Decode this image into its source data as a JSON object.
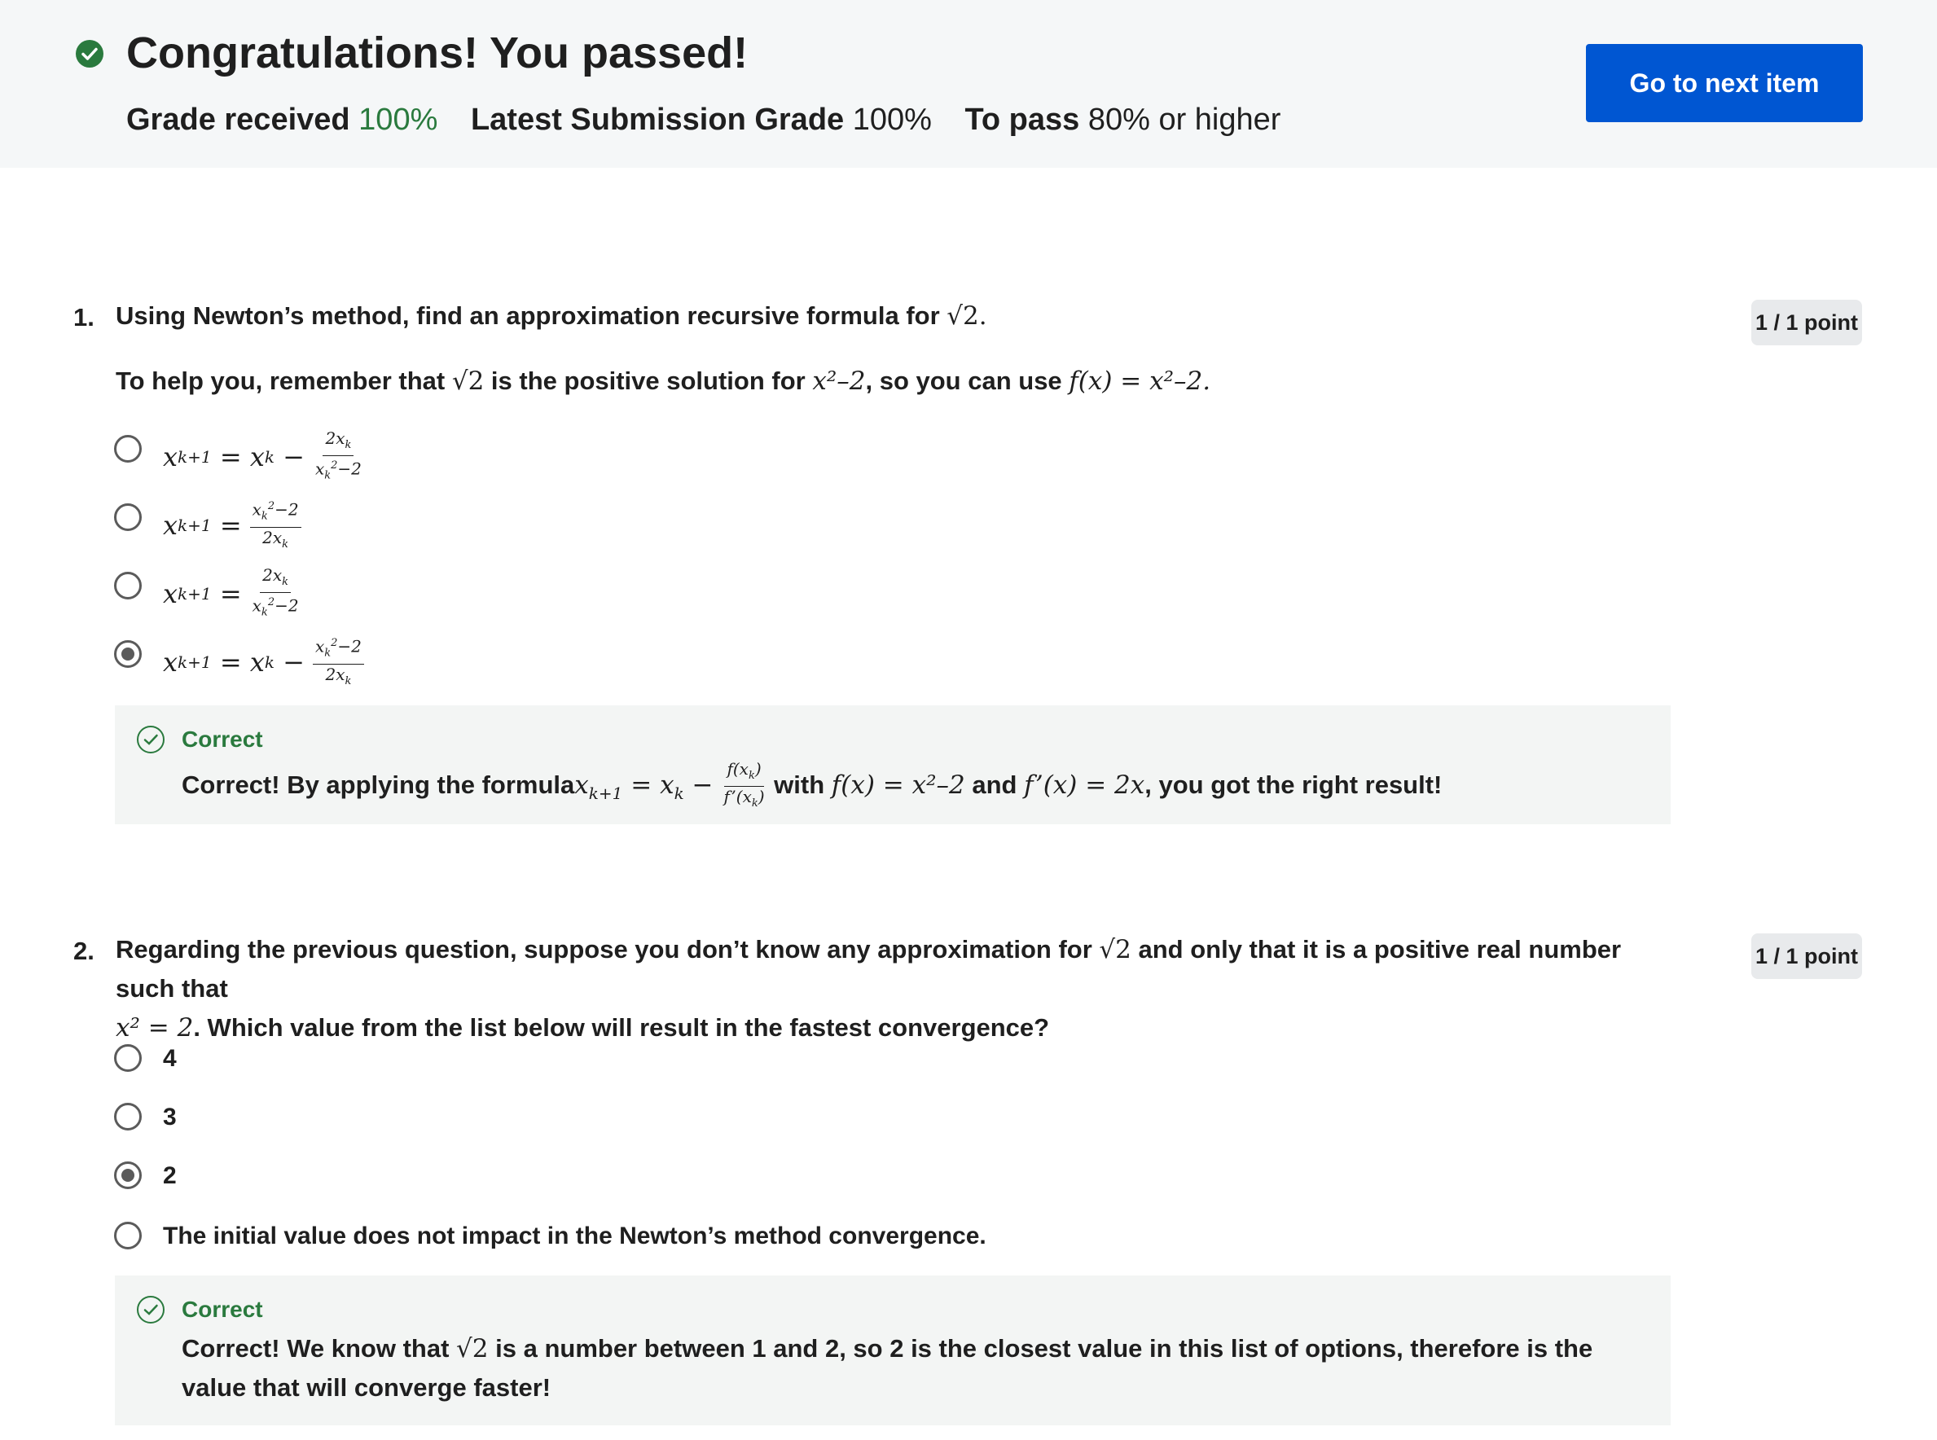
{
  "header": {
    "title": "Congratulations! You passed!",
    "grade_received_label": "Grade received",
    "grade_received_value": "100%",
    "latest_label": "Latest Submission Grade",
    "latest_value": "100%",
    "to_pass_label": "To pass",
    "to_pass_value": "80% or higher",
    "next_button": "Go to next item",
    "accent_color": "#0056d2",
    "success_color": "#2a7a3e"
  },
  "q1": {
    "number": "1.",
    "text_a": "Using Newton’s method, find an approximation recursive formula for ",
    "text_b": "To help you, remember that ",
    "text_c": " is the positive solution for ",
    "text_d": ", so you can use ",
    "points": "1 / 1 point",
    "options": [
      {
        "lhs": "x",
        "sub": "k+1",
        "rhs": "= x",
        "rsub": "k",
        "op": " −",
        "num": "2x",
        "den": "x²−2"
      },
      {
        "lhs": "x",
        "sub": "k+1",
        "rhs": "=",
        "rsub": "",
        "op": "",
        "num": "x²−2",
        "den": "2x"
      },
      {
        "lhs": "x",
        "sub": "k+1",
        "rhs": "=",
        "rsub": "",
        "op": "",
        "num": "2x",
        "den": "x²−2"
      },
      {
        "lhs": "x",
        "sub": "k+1",
        "rhs": "= x",
        "rsub": "k",
        "op": " −",
        "num": "x²−2",
        "den": "2x"
      }
    ],
    "feedback_head": "Correct",
    "feedback_a": "Correct! By applying the formula",
    "feedback_b": " with ",
    "feedback_c": " and ",
    "feedback_d": ", you got the right result!"
  },
  "q2": {
    "number": "2.",
    "text_a": "Regarding the previous question, suppose you don’t know any approximation for ",
    "text_b": " and only that it is a positive real number such that",
    "text_c": ". Which value from the list below will result in the fastest convergence?",
    "points": "1 / 1 point",
    "options": [
      "4",
      "3",
      "2",
      "The initial value does not impact in the Newton’s method convergence."
    ],
    "feedback_head": "Correct",
    "feedback_a": "Correct! We know that ",
    "feedback_b": " is a number between 1 and 2, so 2 is the closest value in this list of options, therefore is the value that will converge faster!"
  }
}
